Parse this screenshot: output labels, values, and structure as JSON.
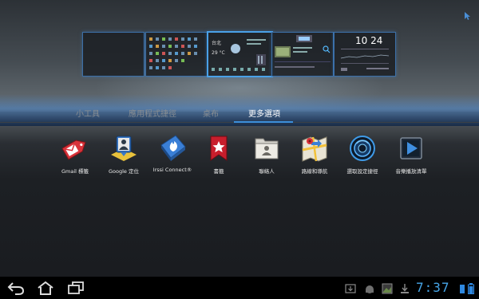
{
  "tabs": [
    {
      "label": "小工具"
    },
    {
      "label": "應用程式捷徑"
    },
    {
      "label": "桌布"
    },
    {
      "label": "更多選項"
    }
  ],
  "active_tab": 3,
  "previews": {
    "weather_city": "台北",
    "weather_temp": "29 °C",
    "clock": "10 24"
  },
  "apps": [
    {
      "label": "Gmail 標籤",
      "icon": "gmail-label-icon"
    },
    {
      "label": "Google 定位",
      "icon": "google-latitude-icon"
    },
    {
      "label": "Irssi Connect®",
      "icon": "irssi-connect-icon"
    },
    {
      "label": "書籤",
      "icon": "bookmark-icon"
    },
    {
      "label": "聯絡人",
      "icon": "contacts-icon"
    },
    {
      "label": "路線和導航",
      "icon": "directions-icon"
    },
    {
      "label": "選取設定捷徑",
      "icon": "settings-shortcut-icon"
    },
    {
      "label": "音樂播放清單",
      "icon": "music-playlist-icon"
    }
  ],
  "status": {
    "time": "7:37"
  },
  "colors": {
    "accent": "#3d8fd9",
    "clock": "#47a6e8"
  }
}
